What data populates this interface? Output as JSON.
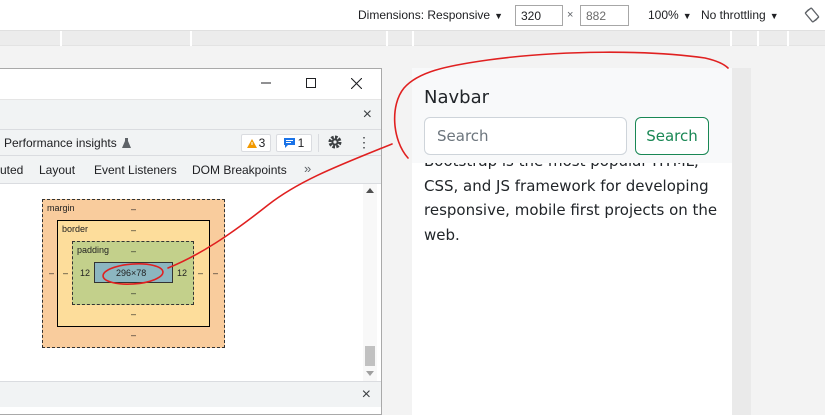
{
  "device_toolbar": {
    "dimensions_label": "Dimensions: Responsive",
    "width_value": "320",
    "times": "×",
    "height_value": "882",
    "zoom": "100%",
    "throttle": "No throttling"
  },
  "preview": {
    "brand": "Navbar",
    "search_placeholder": "Search",
    "search_button": "Search",
    "body_text": "Bootstrap is the most popular HTML, CSS, and JS framework for developing responsive, mobile first projects on the web."
  },
  "devtools": {
    "window_close": "×",
    "panel_label": "Performance insights",
    "warnings_count": "3",
    "messages_count": "1",
    "subtabs": [
      "uted",
      "Layout",
      "Event Listeners",
      "DOM Breakpoints"
    ],
    "more_tabs": "»",
    "box_model": {
      "margin_label": "margin",
      "border_label": "border",
      "padding_label": "padding",
      "margin_top": "–",
      "margin_bottom": "–",
      "margin_left": "–",
      "margin_right": "–",
      "border_top": "–",
      "border_bottom": "–",
      "border_left": "–",
      "border_right": "–",
      "padding_top": "–",
      "padding_bottom": "–",
      "padding_left": "12",
      "padding_right": "12",
      "content_size": "296×78"
    },
    "bottom_close": "×"
  },
  "colors": {
    "annotation": "#e02020",
    "bootstrap_success": "#198754",
    "margin_fill": "#f9cc9d",
    "border_fill": "#fddd9b",
    "padding_fill": "#c3d08b",
    "content_fill": "#8cb6c0"
  },
  "icons": [
    "caret-down-icon",
    "rotate-icon",
    "minimize-icon",
    "maximize-icon",
    "close-icon",
    "flask-icon",
    "warning-icon",
    "message-icon",
    "gear-icon",
    "kebab-icon",
    "chevron-right-double-icon",
    "scroll-up-icon",
    "scroll-down-icon"
  ]
}
